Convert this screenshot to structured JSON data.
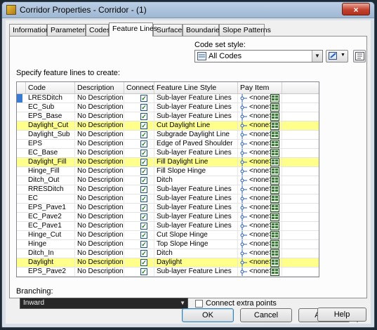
{
  "window": {
    "title": "Corridor Properties - Corridor - (1)",
    "close_glyph": "×"
  },
  "tabs": [
    "Information",
    "Parameters",
    "Codes",
    "Feature Lines",
    "Surfaces",
    "Boundaries",
    "Slope Patterns"
  ],
  "active_tab": "Feature Lines",
  "code_set_style": {
    "label": "Code set style:",
    "value": "All Codes"
  },
  "specify_label": "Specify feature lines to create:",
  "columns": [
    "Code",
    "Description",
    "Connect",
    "Feature Line Style",
    "Pay Item"
  ],
  "rows": [
    {
      "code": "LRESDitch",
      "description": "No Description",
      "connect": true,
      "style": "Sub-layer Feature Lines",
      "pay": "<none>",
      "highlight": false
    },
    {
      "code": "EC_Sub",
      "description": "No Description",
      "connect": true,
      "style": "Sub-layer Feature Lines",
      "pay": "<none>",
      "highlight": false
    },
    {
      "code": "EPS_Base",
      "description": "No Description",
      "connect": true,
      "style": "Sub-layer Feature Lines",
      "pay": "<none>",
      "highlight": false
    },
    {
      "code": "Daylight_Cut",
      "description": "No Description",
      "connect": true,
      "style": "Cut Daylight Line",
      "pay": "<none>",
      "highlight": true
    },
    {
      "code": "Daylight_Sub",
      "description": "No Description",
      "connect": true,
      "style": "Subgrade Daylight Line",
      "pay": "<none>",
      "highlight": false
    },
    {
      "code": "EPS",
      "description": "No Description",
      "connect": true,
      "style": "Edge of Paved Shoulder",
      "pay": "<none>",
      "highlight": false
    },
    {
      "code": "EC_Base",
      "description": "No Description",
      "connect": true,
      "style": "Sub-layer Feature Lines",
      "pay": "<none>",
      "highlight": false
    },
    {
      "code": "Daylight_Fill",
      "description": "No Description",
      "connect": true,
      "style": "Fill Daylight Line",
      "pay": "<none>",
      "highlight": true
    },
    {
      "code": "Hinge_Fill",
      "description": "No Description",
      "connect": true,
      "style": "Fill Slope Hinge",
      "pay": "<none>",
      "highlight": false
    },
    {
      "code": "Ditch_Out",
      "description": "No Description",
      "connect": true,
      "style": "Ditch",
      "pay": "<none>",
      "highlight": false
    },
    {
      "code": "RRESDitch",
      "description": "No Description",
      "connect": true,
      "style": "Sub-layer Feature Lines",
      "pay": "<none>",
      "highlight": false
    },
    {
      "code": "EC",
      "description": "No Description",
      "connect": true,
      "style": "Sub-layer Feature Lines",
      "pay": "<none>",
      "highlight": false
    },
    {
      "code": "EPS_Pave1",
      "description": "No Description",
      "connect": true,
      "style": "Sub-layer Feature Lines",
      "pay": "<none>",
      "highlight": false
    },
    {
      "code": "EC_Pave2",
      "description": "No Description",
      "connect": true,
      "style": "Sub-layer Feature Lines",
      "pay": "<none>",
      "highlight": false
    },
    {
      "code": "EC_Pave1",
      "description": "No Description",
      "connect": true,
      "style": "Sub-layer Feature Lines",
      "pay": "<none>",
      "highlight": false
    },
    {
      "code": "Hinge_Cut",
      "description": "No Description",
      "connect": true,
      "style": "Cut Slope Hinge",
      "pay": "<none>",
      "highlight": false
    },
    {
      "code": "Hinge",
      "description": "No Description",
      "connect": true,
      "style": "Top Slope Hinge",
      "pay": "<none>",
      "highlight": false
    },
    {
      "code": "Ditch_In",
      "description": "No Description",
      "connect": true,
      "style": "Ditch",
      "pay": "<none>",
      "highlight": false
    },
    {
      "code": "Daylight",
      "description": "No Description",
      "connect": true,
      "style": "Daylight",
      "pay": "<none>",
      "highlight": true
    },
    {
      "code": "EPS_Pave2",
      "description": "No Description",
      "connect": true,
      "style": "Sub-layer Feature Lines",
      "pay": "<none>",
      "highlight": false
    }
  ],
  "branching": {
    "label": "Branching:",
    "value": "Inward"
  },
  "connect_extra": {
    "label": "Connect extra points",
    "checked": false
  },
  "buttons": {
    "ok": "OK",
    "cancel": "Cancel",
    "apply": "Apply",
    "help": "Help"
  },
  "colors": {
    "highlight": "#ffff8c",
    "check": "#1a7a1a",
    "title_bar": "#9fb7d2"
  }
}
